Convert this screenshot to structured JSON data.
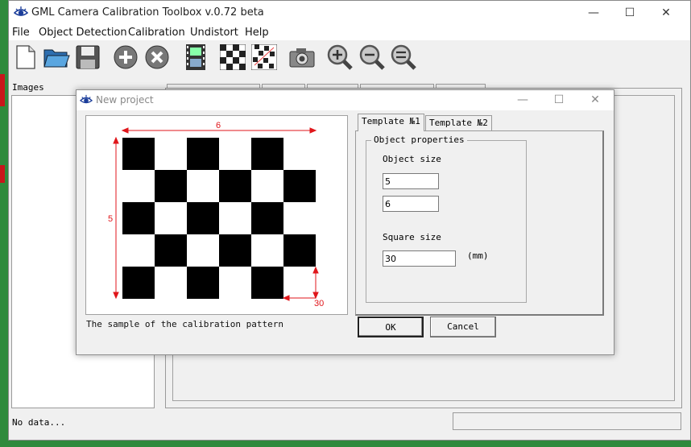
{
  "app": {
    "title": "GML Camera Calibration Toolbox  v.0.72 beta",
    "controls": {
      "minimize": "—",
      "maximize": "☐",
      "close": "✕"
    }
  },
  "menu": [
    "File",
    "Object Detection",
    "Calibration",
    "Undistort",
    "Help"
  ],
  "toolbar": {
    "buttons": [
      "new-project-icon",
      "open-folder-icon",
      "save-disk-icon",
      "add-icon",
      "remove-icon",
      "film-strip-icon",
      "checkerboard-icon",
      "checkerboard-alt-icon",
      "camera-icon",
      "zoom-in-icon",
      "zoom-out-icon",
      "zoom-fit-icon"
    ]
  },
  "main": {
    "images_label": "Images",
    "status_text": "No data..."
  },
  "dialog": {
    "title": "New project",
    "controls": {
      "minimize": "—",
      "maximize": "☐",
      "close": "✕"
    },
    "pattern": {
      "columns_label": "6",
      "rows_label": "5",
      "square_label": "30",
      "caption": "The sample of the calibration pattern",
      "rows": 5,
      "columns": 6
    },
    "tabs": [
      "Template №1",
      "Template №2"
    ],
    "group_title": "Object properties",
    "object_size_label": "Object size",
    "object_size_rows": "5",
    "object_size_cols": "6",
    "square_size_label": "Square size",
    "square_size_value": "30",
    "unit_label": "(mm)",
    "ok_label": "OK",
    "cancel_label": "Cancel"
  },
  "colors": {
    "accent_red": "#e0161b",
    "desktop_green": "#2f8a3c"
  }
}
